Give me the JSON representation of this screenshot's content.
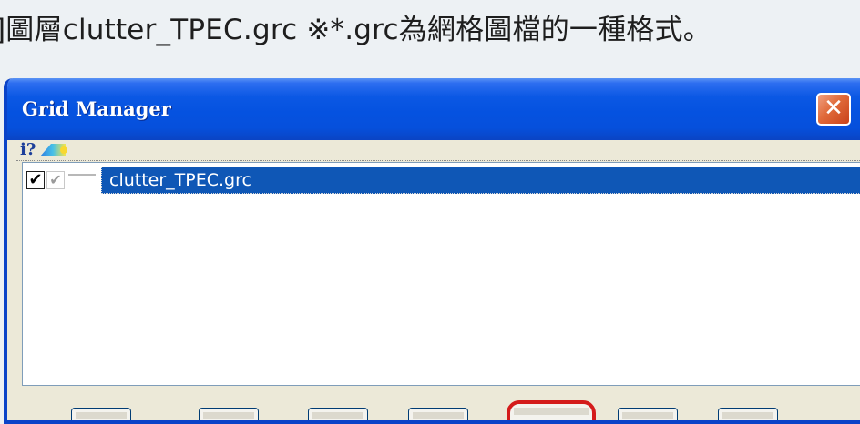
{
  "caption": {
    "text": "]圖層clutter_TPEC.grc ※*.grc為網格圖檔的一種格式。"
  },
  "window": {
    "title": "Grid Manager",
    "close_glyph": "✕"
  },
  "toolbar": {
    "info_label": "i?",
    "layer_icon": "layer-color-icon"
  },
  "list": {
    "items": [
      {
        "label": "clutter_TPEC.grc",
        "checked": true,
        "selected": true
      }
    ]
  },
  "colors": {
    "titlebar": "#0552e0",
    "selection": "#0f57b6",
    "highlight_border": "#d41b1b",
    "close_button": "#e06a3a"
  }
}
